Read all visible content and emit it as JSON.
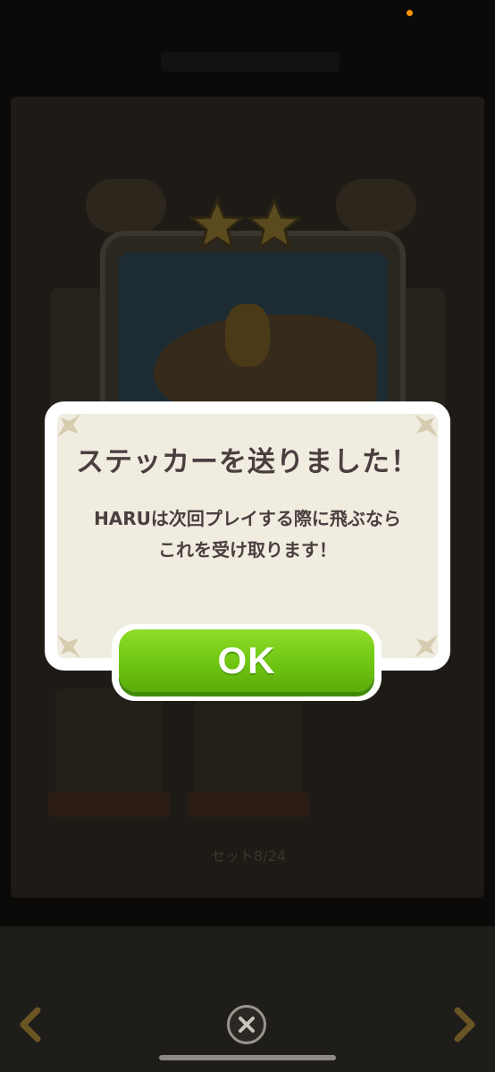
{
  "dialog": {
    "title": "ステッカーを送りました！",
    "message_line1": "HARUは次回プレイする際に飛ぶなら",
    "message_line2": "これを受け取ります！",
    "ok_label": "OK"
  },
  "background": {
    "set_label": "セット8/24"
  },
  "colors": {
    "ok_green": "#6fc612",
    "title_text": "#4a3f3f",
    "dialog_bg": "#f0ece0",
    "star_gold": "#e8c240"
  },
  "icons": {
    "close": "close-icon",
    "prev": "chevron-left-icon",
    "next": "chevron-right-icon"
  }
}
